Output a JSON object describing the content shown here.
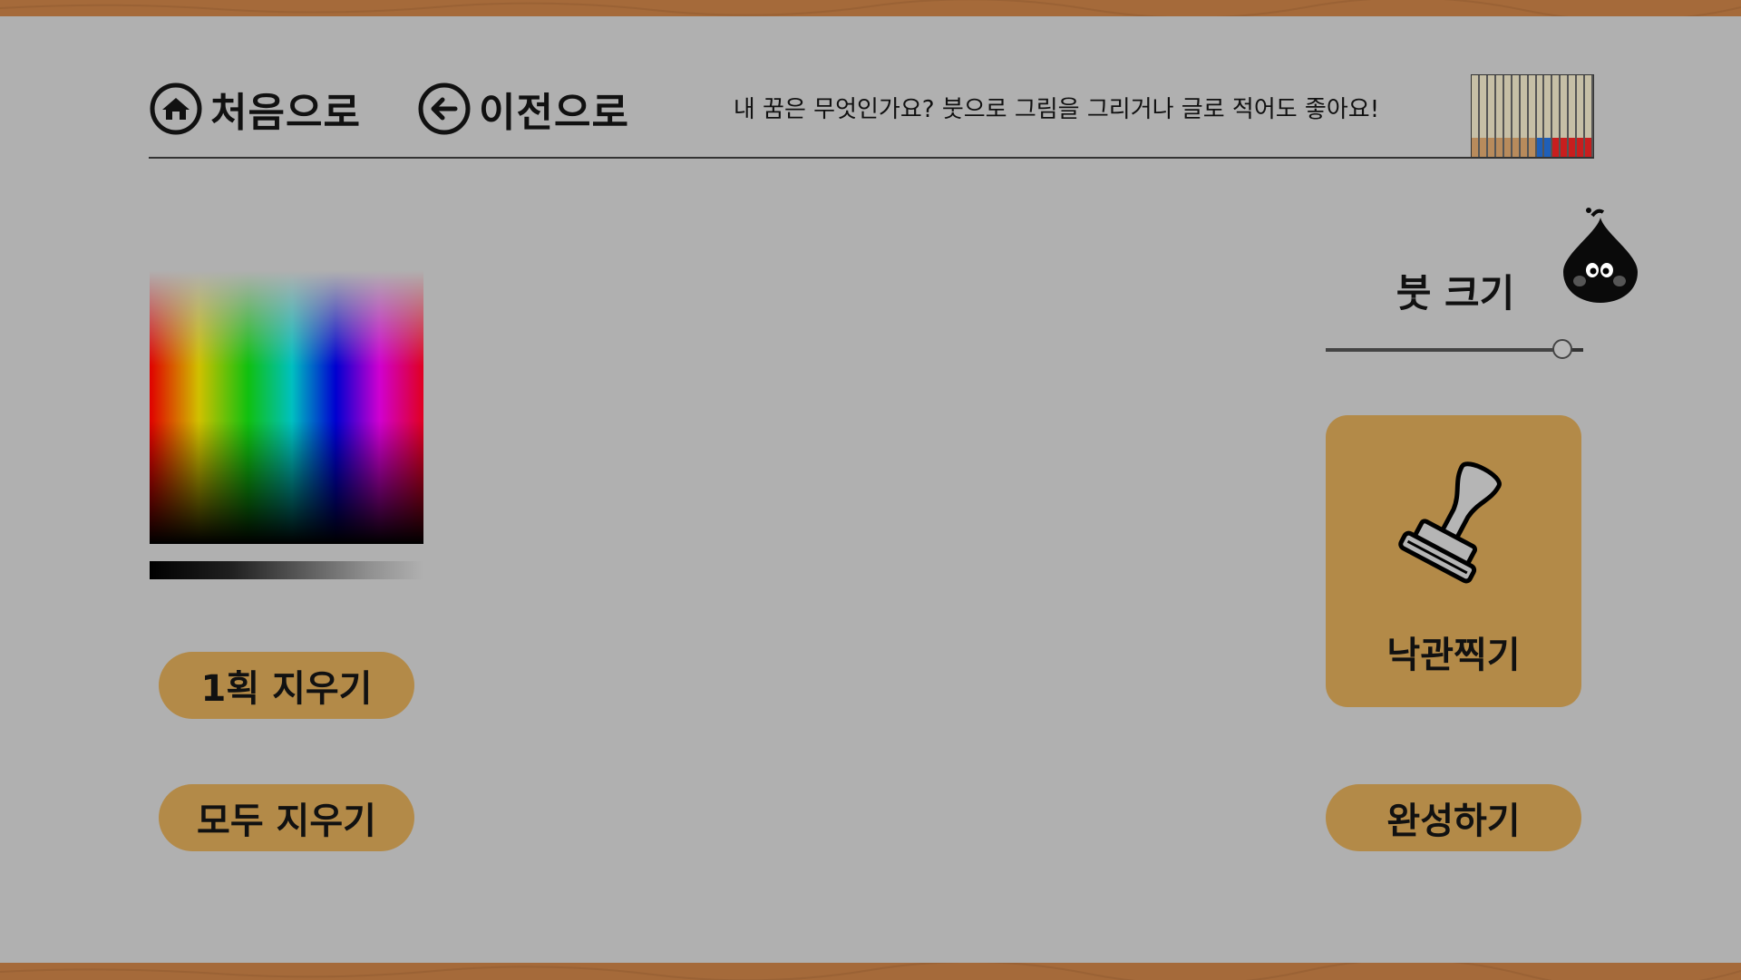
{
  "colors": {
    "background": "#b0b0b0",
    "border_wood": "#a56a3a",
    "button_fill": "#b38a48",
    "text": "#111111"
  },
  "nav": {
    "home": {
      "label": "처음으로",
      "icon": "home-icon"
    },
    "back": {
      "label": "이전으로",
      "icon": "arrow-left-icon"
    }
  },
  "prompt": "내 꿈은 무엇인가요?  붓으로 그림을 그리거나 글로 적어도 좋아요!",
  "progress": {
    "total_cells": 15,
    "colors": [
      "#b88b5c",
      "#b88b5c",
      "#b88b5c",
      "#b88b5c",
      "#b88b5c",
      "#b88b5c",
      "#b88b5c",
      "#b88b5c",
      "#1f5fb8",
      "#1f5fb8",
      "#c81e1e",
      "#c81e1e",
      "#c81e1e",
      "#c81e1e",
      "#c81e1e"
    ]
  },
  "tools": {
    "undo_label": "1획 지우기",
    "clear_label": "모두 지우기",
    "brush_size_label": "붓 크기",
    "brush_size_value": 0.92,
    "stamp_label": "낙관찍기",
    "finish_label": "완성하기"
  }
}
